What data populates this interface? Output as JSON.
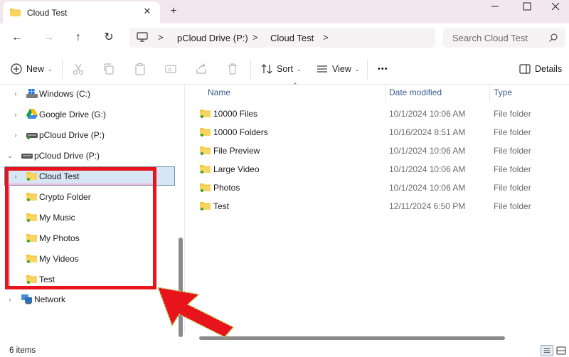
{
  "window": {
    "tab_title": "Cloud Test",
    "close_tab_glyph": "✕",
    "new_tab_glyph": "+",
    "minimize_glyph": "—",
    "maximize_glyph": "☐",
    "close_glyph": "✕"
  },
  "nav": {
    "back_glyph": "←",
    "forward_glyph": "→",
    "up_glyph": "↑",
    "refresh_glyph": "↻"
  },
  "address": {
    "separator": ">",
    "crumbs": [
      "pCloud Drive (P:)",
      "Cloud Test"
    ]
  },
  "search": {
    "placeholder": "Search Cloud Test"
  },
  "toolbar": {
    "new_label": "New",
    "sort_label": "Sort",
    "view_label": "View",
    "more_glyph": "•••",
    "details_label": "Details"
  },
  "tree": {
    "items": [
      {
        "label": "Windows (C:)",
        "icon": "windows-drive-icon"
      },
      {
        "label": "Google Drive (G:)",
        "icon": "google-drive-icon"
      },
      {
        "label": "pCloud Drive (P:)",
        "icon": "pcloud-drive-icon"
      },
      {
        "label": "pCloud Drive (P:)",
        "icon": "pcloud-drive-icon",
        "expanded": true
      },
      {
        "label": "Cloud Test",
        "icon": "folder-icon",
        "selected": true
      },
      {
        "label": "Crypto Folder",
        "icon": "folder-icon"
      },
      {
        "label": "My Music",
        "icon": "folder-icon"
      },
      {
        "label": "My Photos",
        "icon": "folder-icon"
      },
      {
        "label": "My Videos",
        "icon": "folder-icon"
      },
      {
        "label": "Test",
        "icon": "folder-icon"
      },
      {
        "label": "Network",
        "icon": "network-icon"
      }
    ]
  },
  "list": {
    "columns": [
      "Name",
      "Date modified",
      "Type"
    ],
    "rows": [
      {
        "name": "10000 Files",
        "date": "10/1/2024 10:06 AM",
        "type": "File folder"
      },
      {
        "name": "10000 Folders",
        "date": "10/16/2024 8:51 AM",
        "type": "File folder"
      },
      {
        "name": "File Preview",
        "date": "10/1/2024 10:06 AM",
        "type": "File folder"
      },
      {
        "name": "Large Video",
        "date": "10/1/2024 10:06 AM",
        "type": "File folder"
      },
      {
        "name": "Photos",
        "date": "10/1/2024 10:06 AM",
        "type": "File folder"
      },
      {
        "name": "Test",
        "date": "12/11/2024 6:50 PM",
        "type": "File folder"
      }
    ]
  },
  "status": {
    "item_count": "6 items"
  },
  "colors": {
    "folder": "#f5c842",
    "sync_badge": "#3aa53a",
    "annotation": "#e8141b",
    "selection": "#d6e6f5",
    "titlebar": "#f3e7ee"
  }
}
